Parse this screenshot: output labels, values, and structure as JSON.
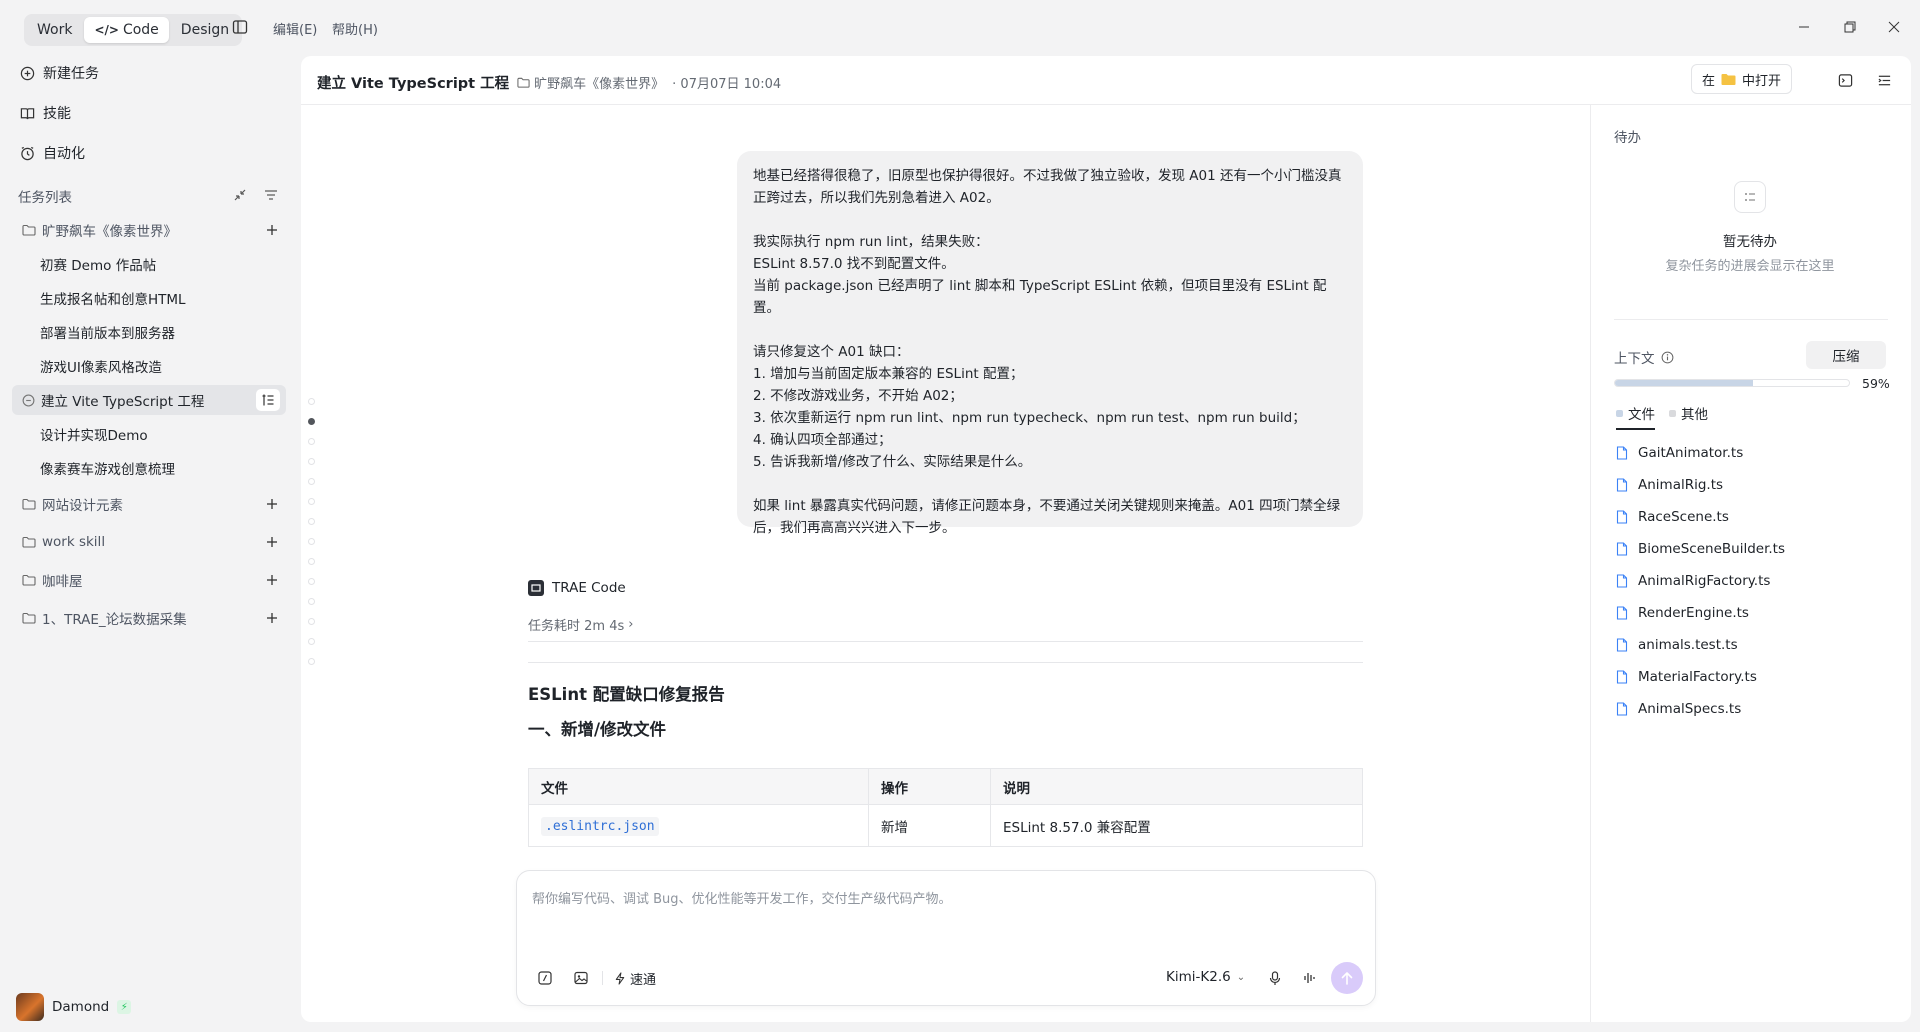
{
  "topbar": {
    "modes": [
      "Work",
      "Code",
      "Design"
    ],
    "active_mode": "Code",
    "menus": [
      "编辑(E)",
      "帮助(H)"
    ]
  },
  "sidebar": {
    "actions": [
      {
        "label": "新建任务",
        "icon": "add-circle-icon"
      },
      {
        "label": "技能",
        "icon": "book-icon"
      },
      {
        "label": "自动化",
        "icon": "clock-icon"
      }
    ],
    "list_title": "任务列表",
    "groups": [
      {
        "name": "旷野飙车《像素世界》",
        "tasks": [
          "初赛 Demo 作品帖",
          "生成报名帖和创意HTML",
          "部署当前版本到服务器",
          "游戏UI像素风格改造"
        ]
      },
      {
        "name": "网站设计元素",
        "tasks": []
      },
      {
        "name": "work skill",
        "tasks": []
      },
      {
        "name": "咖啡屋",
        "tasks": []
      },
      {
        "name": "1、TRAE_论坛数据采集",
        "tasks": []
      }
    ],
    "active_task": "建立 Vite TypeScript 工程",
    "tasks_after_active": [
      "设计并实现Demo",
      "像素赛车游戏创意梳理"
    ]
  },
  "header": {
    "title": "建立 Vite TypeScript 工程",
    "project": "旷野飙车《像素世界》",
    "time": "· 07月07日 10:04",
    "open_in_prefix": "在",
    "open_in_suffix": "中打开"
  },
  "message": {
    "lines": [
      "地基已经搭得很稳了，旧原型也保护得很好。不过我做了独立验收，发现 A01 还有一个小门槛没真",
      "正跨过去，所以我们先别急着进入 A02。",
      "",
      "我实际执行 npm run lint，结果失败：",
      "ESLint 8.57.0 找不到配置文件。",
      "当前 package.json 已经声明了 lint 脚本和 TypeScript ESLint 依赖，但项目里没有 ESLint 配置。",
      "",
      "请只修复这个 A01 缺口：",
      "1. 增加与当前固定版本兼容的 ESLint 配置；",
      "2. 不修改游戏业务，不开始 A02；",
      "3. 依次重新运行 npm run lint、npm run typecheck、npm run test、npm run build；",
      "4. 确认四项全部通过；",
      "5. 告诉我新增/修改了什么、实际结果是什么。",
      "",
      "如果 lint 暴露真实代码问题，请修正问题本身，不要通过关闭关键规则来掩盖。A01 四项门禁全绿",
      "后，我们再高高兴兴进入下一步。"
    ]
  },
  "agent": {
    "name": "TRAE Code",
    "elapsed": "任务耗时 2m 4s",
    "report_title": "ESLint 配置缺口修复报告",
    "section_title": "一、新增/修改文件",
    "table": {
      "headers": [
        "文件",
        "操作",
        "说明"
      ],
      "rows": [
        [
          ".eslintrc.json",
          "新增",
          "ESLint 8.57.0 兼容配置"
        ]
      ]
    }
  },
  "composer": {
    "placeholder": "帮你编写代码、调试 Bug、优化性能等开发工作，交付生产级代码产物。",
    "speed_label": "速通",
    "model": "Kimi-K2.6"
  },
  "right_panel": {
    "todo_title": "待办",
    "empty_title": "暂无待办",
    "empty_sub": "复杂任务的进展会显示在这里",
    "context_label": "上下文",
    "compress_label": "压缩",
    "context_usage": 0.59,
    "context_pct_text": "59%",
    "tabs": [
      "文件",
      "其他"
    ],
    "files": [
      "GaitAnimator.ts",
      "AnimalRig.ts",
      "RaceScene.ts",
      "BiomeSceneBuilder.ts",
      "AnimalRigFactory.ts",
      "RenderEngine.ts",
      "animals.test.ts",
      "MaterialFactory.ts",
      "AnimalSpecs.ts"
    ]
  },
  "user": {
    "name": "Damond"
  },
  "colors": {
    "accent_send": "#d9cbfa",
    "link_code": "#2f6fd6",
    "badge_green": "#22c55e"
  }
}
